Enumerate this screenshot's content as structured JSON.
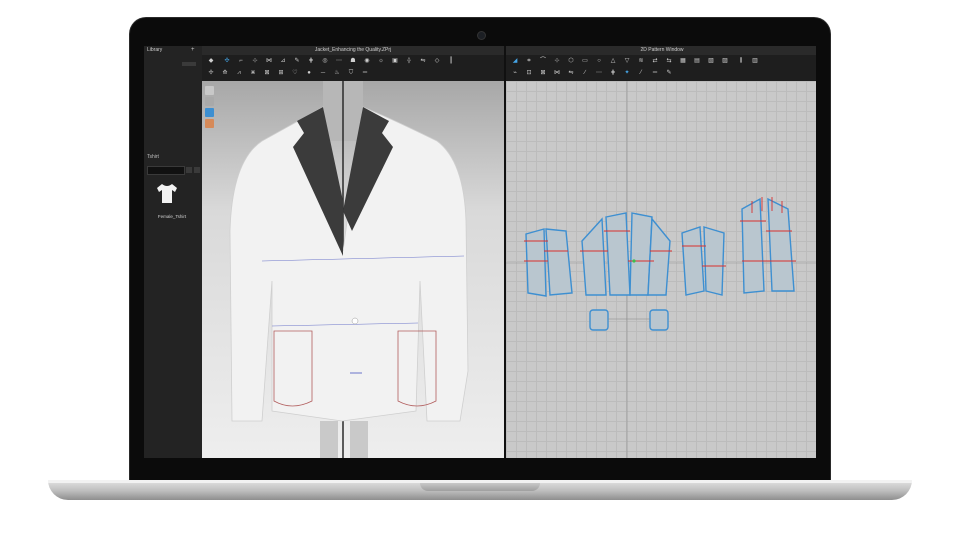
{
  "app": {
    "library_title": "Library",
    "library_section": "Tshirt",
    "library_item_label": "Female_Tshirt",
    "view3d_title": "Jacket_Enhancing the Quality.ZPrj",
    "view2d_title": "2D Pattern Window"
  },
  "colors": {
    "bezel": "#0b0b0b",
    "panel_dark": "#1e1e1e",
    "viewport_2d_bg": "#c9c9c9",
    "pattern_outline": "#3d8fd1",
    "seam_red": "#d9302e",
    "jacket_white": "#f4f4f4",
    "lapel_dark": "#3b3b3b"
  },
  "icons": {
    "library": "tshirt-icon",
    "side_tools": [
      "avatar-icon",
      "garment-icon",
      "fabric-icon",
      "texture-icon"
    ]
  }
}
